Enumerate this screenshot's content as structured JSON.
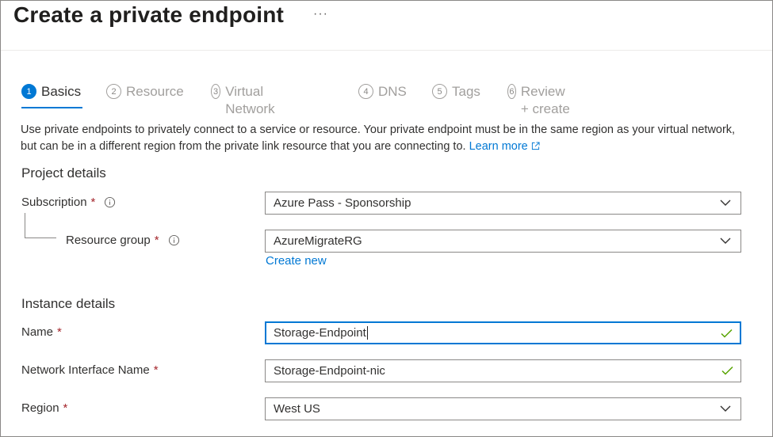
{
  "header": {
    "title": "Create a private endpoint",
    "more_label": "···"
  },
  "tabs": [
    {
      "num": "1",
      "label": "Basics",
      "active": true
    },
    {
      "num": "2",
      "label": "Resource"
    },
    {
      "num": "3",
      "label": "Virtual Network"
    },
    {
      "num": "4",
      "label": "DNS"
    },
    {
      "num": "5",
      "label": "Tags"
    },
    {
      "num": "6",
      "label": "Review + create"
    }
  ],
  "intro": {
    "text": "Use private endpoints to privately connect to a service or resource. Your private endpoint must be in the same region as your virtual network, but can be in a different region from the private link resource that you are connecting to.",
    "learn_more": "Learn more"
  },
  "project": {
    "heading": "Project details",
    "subscription": {
      "label": "Subscription",
      "required": "*",
      "value": "Azure Pass - Sponsorship"
    },
    "resource_group": {
      "label": "Resource group",
      "required": "*",
      "value": "AzureMigrateRG"
    },
    "create_new": "Create new"
  },
  "instance": {
    "heading": "Instance details",
    "name": {
      "label": "Name",
      "required": "*",
      "value": "Storage-Endpoint"
    },
    "nic": {
      "label": "Network Interface Name",
      "required": "*",
      "value": "Storage-Endpoint-nic"
    },
    "region": {
      "label": "Region",
      "required": "*",
      "value": "West US"
    }
  },
  "colors": {
    "accent": "#0078d4",
    "required": "#a4262c",
    "valid": "#57a300"
  }
}
